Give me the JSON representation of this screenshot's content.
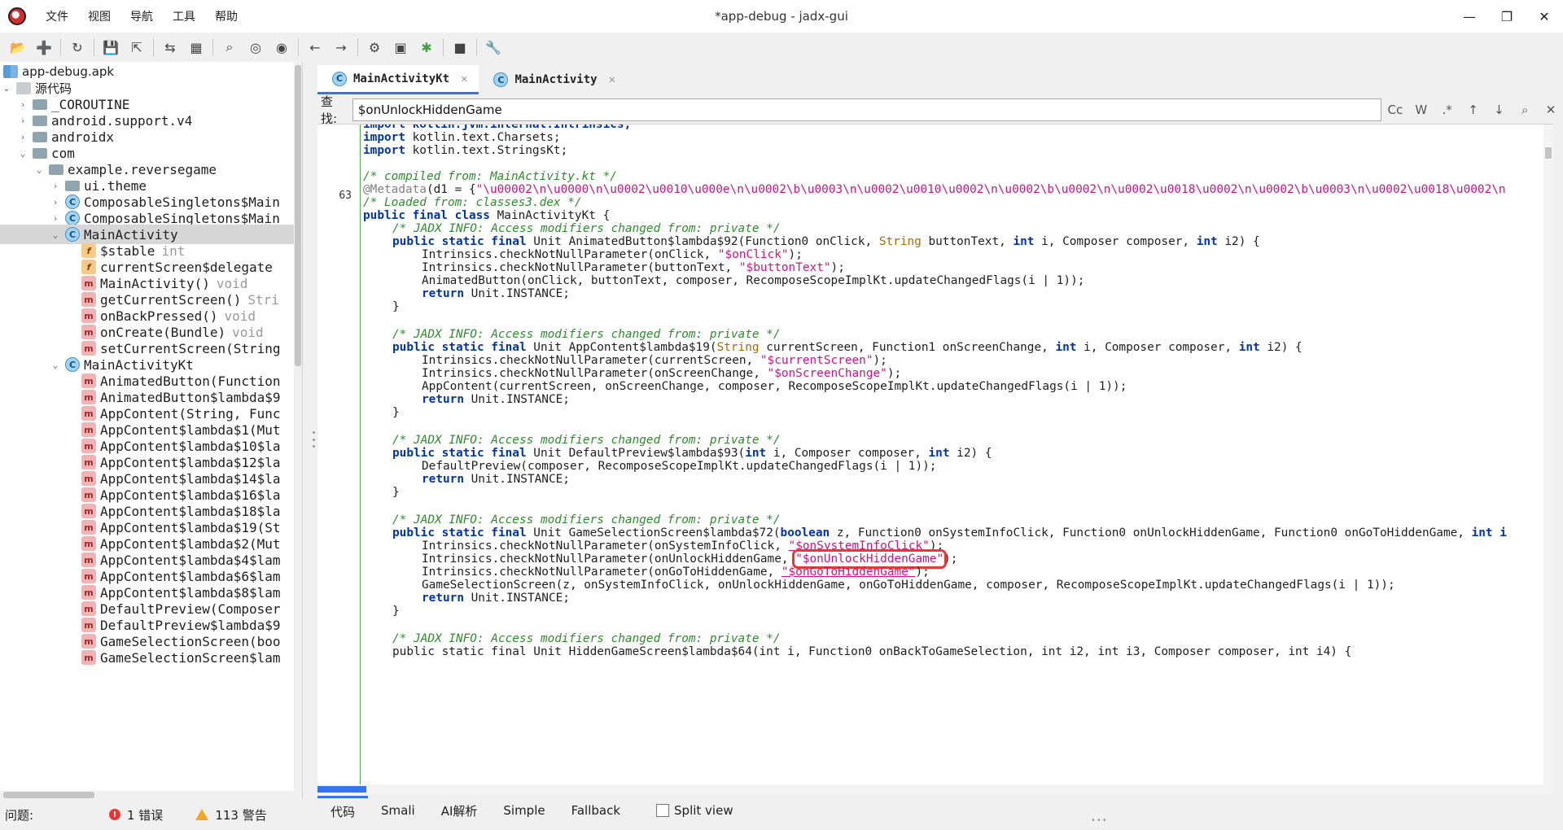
{
  "window": {
    "title": "*app-debug - jadx-gui",
    "menu": [
      "文件",
      "视图",
      "导航",
      "工具",
      "帮助"
    ]
  },
  "toolbar": [
    "open-icon",
    "add-files-icon",
    "reload-icon",
    "save-icon",
    "export-icon",
    "sync-tree-icon",
    "flatten-packages-icon",
    "search-icon",
    "search-class-icon",
    "search-usage-icon",
    "back-icon",
    "forward-icon",
    "deobfuscation-icon",
    "quark-icon",
    "debugger-icon",
    "log-icon",
    "preferences-icon"
  ],
  "tree": {
    "root": "app-debug.apk",
    "sources": "源代码",
    "packages": [
      "_COROUTINE",
      "android.support.v4",
      "androidx",
      "com",
      "example.reversegame",
      "ui.theme"
    ],
    "classes": [
      "ComposableSingletons$Main",
      "ComposableSingletons$Main",
      "MainActivity"
    ],
    "main_activity_members": [
      {
        "name": "$stable",
        "type": "int"
      },
      {
        "name": "currentScreen$delegate",
        "type": ""
      },
      {
        "name": "MainActivity()",
        "type": "void"
      },
      {
        "name": "getCurrentScreen()",
        "type": "Stri"
      },
      {
        "name": "onBackPressed()",
        "type": "void"
      },
      {
        "name": "onCreate(Bundle)",
        "type": "void"
      },
      {
        "name": "setCurrentScreen(String",
        "type": ""
      }
    ],
    "kt_class": "MainActivityKt",
    "kt_members": [
      "AnimatedButton(Function",
      "AnimatedButton$lambda$9",
      "AppContent(String, Func",
      "AppContent$lambda$1(Mut",
      "AppContent$lambda$10$la",
      "AppContent$lambda$12$la",
      "AppContent$lambda$14$la",
      "AppContent$lambda$16$la",
      "AppContent$lambda$18$la",
      "AppContent$lambda$19(St",
      "AppContent$lambda$2(Mut",
      "AppContent$lambda$4$lam",
      "AppContent$lambda$6$lam",
      "AppContent$lambda$8$lam",
      "DefaultPreview(Composer",
      "DefaultPreview$lambda$9",
      "GameSelectionScreen(boo",
      "GameSelectionScreen$lam"
    ]
  },
  "tabs": [
    {
      "label": "MainActivityKt",
      "active": true
    },
    {
      "label": "MainActivity",
      "active": false
    }
  ],
  "search": {
    "label": "查找:",
    "value": "$onUnlockHiddenGame",
    "options": [
      "Cc",
      "W",
      ".*"
    ]
  },
  "code": {
    "line_number": "63",
    "lines": {
      "l0": "import kotlin.jvm.internal.Intrinsics;",
      "l1a": "import",
      "l1b": " kotlin.text.Charsets;",
      "l2a": "import",
      "l2b": " kotlin.text.StringsKt;",
      "l4": "/* compiled from: MainActivity.kt */",
      "l5a": "@Metadata",
      "l5b": "(d1 = {",
      "l5c": "\"\\u00002\\n\\u0000\\n\\u0002\\u0010\\u000e\\n\\u0002\\b\\u0003\\n\\u0002\\u0010\\u0002\\n\\u0002\\b\\u0002\\n\\u0002\\u0018\\u0002\\n\\u0002\\b\\u0003\\n\\u0002\\u0018\\u0002\\n",
      "l6": "/* Loaded from: classes3.dex */",
      "l7a": "public final class",
      "l7b": " MainActivityKt {",
      "jadx": "/* JADX INFO: Access modifiers changed from: private */",
      "f1": {
        "sig_a": "public static final",
        "sig_b": " Unit AnimatedButton$lambda$92(Function0 onClick, ",
        "sig_c": "String",
        "sig_d": " buttonText, ",
        "sig_e": "int",
        "sig_f": " i, Composer composer, ",
        "sig_g": "int",
        "sig_h": " i2) {",
        "b1a": "Intrinsics.checkNotNullParameter(onClick, ",
        "b1b": "\"$onClick\"",
        "b1c": ");",
        "b2a": "Intrinsics.checkNotNullParameter(buttonText, ",
        "b2b": "\"$buttonText\"",
        "b2c": ");",
        "b3": "AnimatedButton(onClick, buttonText, composer, RecomposeScopeImplKt.updateChangedFlags(i | 1));"
      },
      "f2": {
        "sig_a": "public static final",
        "sig_b": " Unit AppContent$lambda$19(",
        "sig_c": "String",
        "sig_d": " currentScreen, Function1 onScreenChange, ",
        "sig_e": "int",
        "sig_f": " i, Composer composer, ",
        "sig_g": "int",
        "sig_h": " i2) {",
        "b1a": "Intrinsics.checkNotNullParameter(currentScreen, ",
        "b1b": "\"$currentScreen\"",
        "b1c": ");",
        "b2a": "Intrinsics.checkNotNullParameter(onScreenChange, ",
        "b2b": "\"$onScreenChange\"",
        "b2c": ");",
        "b3": "AppContent(currentScreen, onScreenChange, composer, RecomposeScopeImplKt.updateChangedFlags(i | 1));"
      },
      "f3": {
        "sig_a": "public static final",
        "sig_b": " Unit DefaultPreview$lambda$93(",
        "sig_c": "int",
        "sig_d": " i, Composer composer, ",
        "sig_e": "int",
        "sig_f": " i2) {",
        "b1": "DefaultPreview(composer, RecomposeScopeImplKt.updateChangedFlags(i | 1));"
      },
      "f4": {
        "sig_a": "public static final",
        "sig_b": " Unit GameSelectionScreen$lambda$72(",
        "sig_c": "boolean",
        "sig_d": " z, Function0 onSystemInfoClick, Function0 onUnlockHiddenGame, Function0 onGoToHiddenGame, ",
        "sig_e": "int i",
        "b1a": "Intrinsics.checkNotNullParameter(onSystemInfoClick, ",
        "b1b": "\"$onSystemInfoClick\"",
        "b1c": ");",
        "b2a": "Intrinsics.checkNotNullParameter(onUnlockHiddenGame, ",
        "b2b": "\"$onUnlockHiddenGame\"",
        "b2c": ");",
        "b3a": "Intrinsics.checkNotNullParameter(onGoToHiddenGame, ",
        "b3b": "\"$onGoToHiddenGame\"",
        "b3c": ");",
        "b4": "GameSelectionScreen(z, onSystemInfoClick, onUnlockHiddenGame, onGoToHiddenGame, composer, RecomposeScopeImplKt.updateChangedFlags(i | 1));"
      },
      "f5": {
        "sig": "public static final Unit HiddenGameScreen$lambda$64(int i, Function0 onBackToGameSelection, int i2, int i3, Composer composer, int i4) {"
      },
      "ret": "return",
      "ret_val": " Unit.INSTANCE;",
      "close": "}"
    }
  },
  "view_tabs": [
    "代码",
    "Smali",
    "AI解析",
    "Simple",
    "Fallback"
  ],
  "split_view": "Split view",
  "status": {
    "label": "问题:",
    "errors": "1 错误",
    "warnings": "113 警告"
  }
}
